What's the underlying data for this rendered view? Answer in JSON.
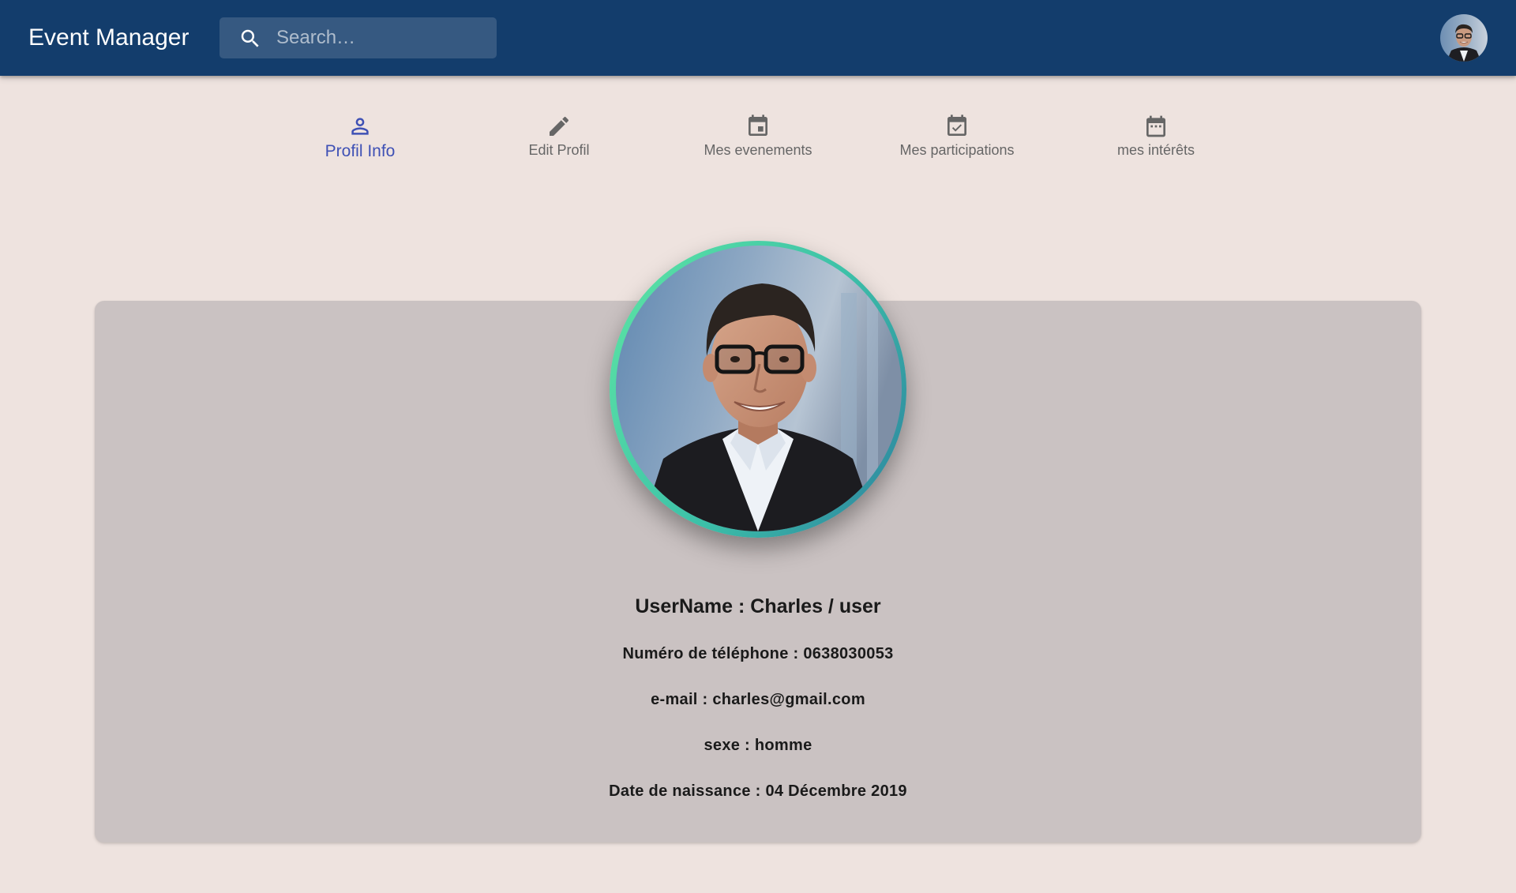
{
  "appbar": {
    "title": "Event Manager",
    "search_placeholder": "Search…",
    "background_color": "#133D6C"
  },
  "tabs": [
    {
      "label": "Profil Info",
      "icon": "person-icon",
      "active": true
    },
    {
      "label": "Edit Profil",
      "icon": "pencil-icon",
      "active": false
    },
    {
      "label": "Mes evenements",
      "icon": "calendar-event-icon",
      "active": false
    },
    {
      "label": "Mes participations",
      "icon": "calendar-check-icon",
      "active": false
    },
    {
      "label": "mes intérêts",
      "icon": "calendar-dots-icon",
      "active": false
    }
  ],
  "colors": {
    "page_background": "#EEE3DF",
    "card_background": "#CAC2C2",
    "active_tab": "#3F51B5",
    "inactive_tab": "#666666"
  },
  "profile": {
    "username_label": "UserName :",
    "username_value": "Charles / user",
    "phone_label": "Numéro de téléphone :",
    "phone_value": "0638030053",
    "email_label": "e-mail :",
    "email_value": "charles@gmail.com",
    "sexe_label": "sexe :",
    "sexe_value": "homme",
    "birth_label": "Date de naissance :",
    "birth_value": "04 Décembre 2019"
  }
}
